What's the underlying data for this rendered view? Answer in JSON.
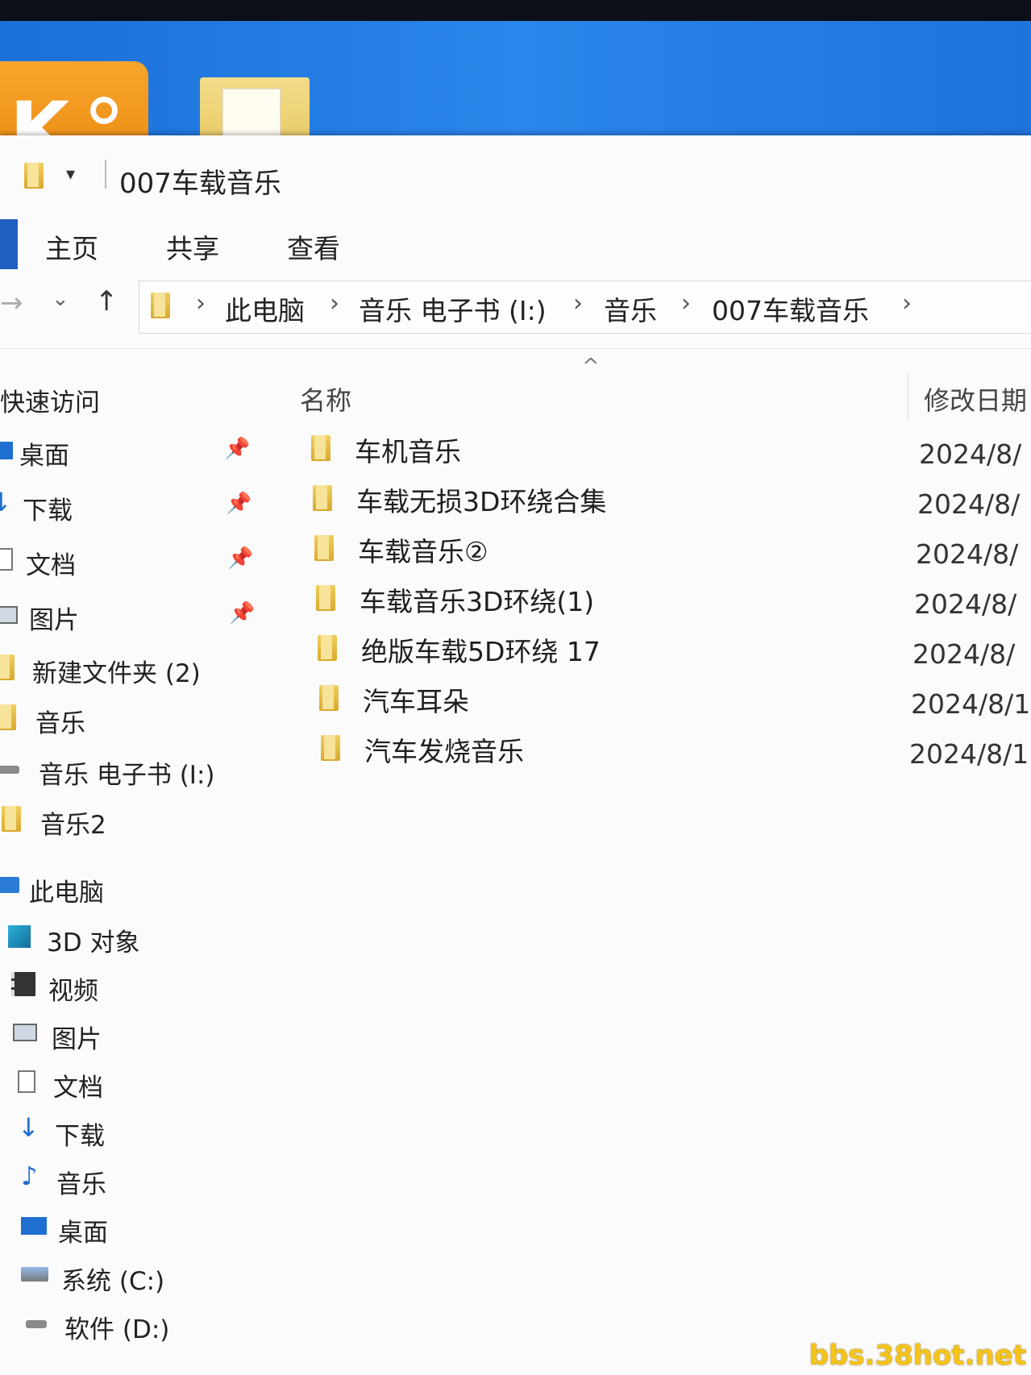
{
  "window": {
    "title": "007车载音乐",
    "quick_access_dropdown": "▾"
  },
  "ribbon": {
    "tabs": [
      "主页",
      "共享",
      "查看"
    ]
  },
  "address": {
    "breadcrumbs": [
      "此电脑",
      "音乐 电子书 (I:)",
      "音乐",
      "007车载音乐"
    ]
  },
  "nav": {
    "quick_access_label": "快速访问",
    "quick_items": [
      {
        "label": "桌面",
        "icon": "desktop-icon",
        "pinned": true
      },
      {
        "label": "下载",
        "icon": "download-icon",
        "pinned": true
      },
      {
        "label": "文档",
        "icon": "document-icon",
        "pinned": true
      },
      {
        "label": "图片",
        "icon": "pictures-icon",
        "pinned": true
      },
      {
        "label": "新建文件夹 (2)",
        "icon": "folder-icon",
        "pinned": false
      },
      {
        "label": "音乐",
        "icon": "folder-icon",
        "pinned": false
      },
      {
        "label": "音乐 电子书 (I:)",
        "icon": "drive-icon",
        "pinned": false
      },
      {
        "label": "音乐2",
        "icon": "folder-icon",
        "pinned": false
      }
    ],
    "this_pc_label": "此电脑",
    "pc_items": [
      {
        "label": "3D 对象",
        "icon": "3d-objects-icon"
      },
      {
        "label": "视频",
        "icon": "video-icon"
      },
      {
        "label": "图片",
        "icon": "pictures-icon"
      },
      {
        "label": "文档",
        "icon": "document-icon"
      },
      {
        "label": "下载",
        "icon": "download-icon"
      },
      {
        "label": "音乐",
        "icon": "music-icon"
      },
      {
        "label": "桌面",
        "icon": "desktop-icon"
      },
      {
        "label": "系统 (C:)",
        "icon": "system-drive-icon"
      },
      {
        "label": "软件 (D:)",
        "icon": "drive-icon"
      }
    ]
  },
  "content": {
    "columns": {
      "name": "名称",
      "date": "修改日期"
    },
    "files": [
      {
        "name": "车机音乐",
        "date": "2024/8/"
      },
      {
        "name": "车载无损3D环绕合集",
        "date": "2024/8/"
      },
      {
        "name": "车载音乐②",
        "date": "2024/8/"
      },
      {
        "name": "车载音乐3D环绕(1)",
        "date": "2024/8/"
      },
      {
        "name": "绝版车载5D环绕 17",
        "date": "2024/8/"
      },
      {
        "name": "汽车耳朵",
        "date": "2024/8/1"
      },
      {
        "name": "汽车发烧音乐",
        "date": "2024/8/1"
      }
    ]
  },
  "watermark": "bbs.38hot.net",
  "colors": {
    "accent": "#1f5fc0",
    "folder": "#e6c35a",
    "desktop_bg": "#2a86ea"
  }
}
